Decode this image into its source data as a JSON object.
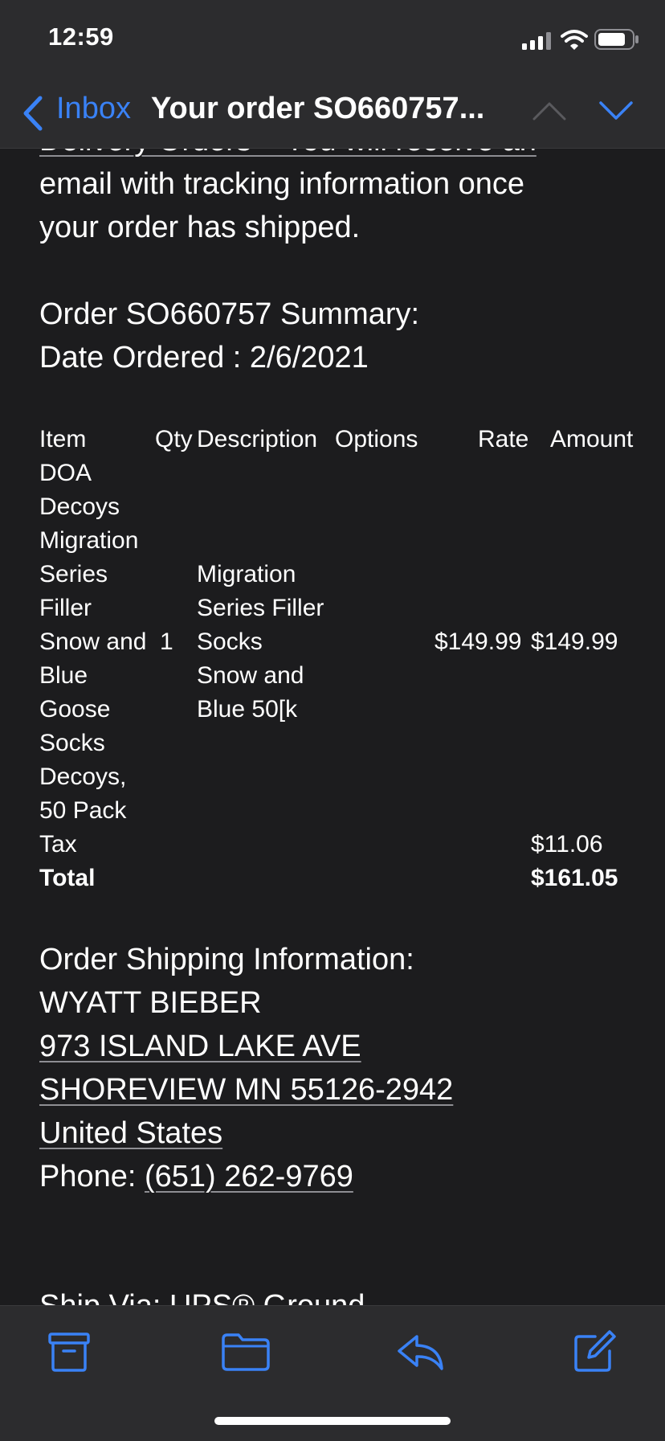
{
  "status_bar": {
    "time": "12:59"
  },
  "nav": {
    "back_label": "Inbox",
    "title": "Your order SO660757..."
  },
  "email": {
    "clipped_top": "Delivery Orders – You will receive an",
    "line1": "email with tracking information once",
    "line2": "your order has shipped.",
    "summary_title": "Order SO660757 Summary:",
    "date_ordered": "Date Ordered : 2/6/2021",
    "table": {
      "headers": {
        "item": "Item",
        "qty": "Qty",
        "description": "Description",
        "options": "Options",
        "rate": "Rate",
        "amount": "Amount"
      },
      "item_lines": [
        "DOA",
        "Decoys",
        "Migration",
        "Series",
        "Filler",
        "Snow and",
        "Blue",
        "Goose",
        "Socks",
        "Decoys,",
        "50 Pack"
      ],
      "qty": "1",
      "description_lines": [
        "Migration",
        "Series Filler",
        "Socks",
        "Snow and",
        "Blue 50[k"
      ],
      "rate": "$149.99",
      "amount": "$149.99",
      "tax_label": "Tax",
      "tax_value": "$11.06",
      "total_label": "Total",
      "total_value": "$161.05"
    },
    "shipping": {
      "heading": "Order Shipping Information:",
      "name": "WYATT BIEBER",
      "street": "973 ISLAND LAKE AVE",
      "city": "SHOREVIEW MN 55126-2942",
      "country": "United States",
      "phone_label": "Phone: ",
      "phone": "(651) 262-9769",
      "ship_via": "Ship Via: UPS® Ground"
    }
  },
  "toolbar": [
    "archive-icon",
    "folder-icon",
    "reply-icon",
    "compose-icon"
  ],
  "colors": {
    "accent": "#3a82f6",
    "background": "#1c1c1e",
    "bars": "#2c2c2e"
  }
}
